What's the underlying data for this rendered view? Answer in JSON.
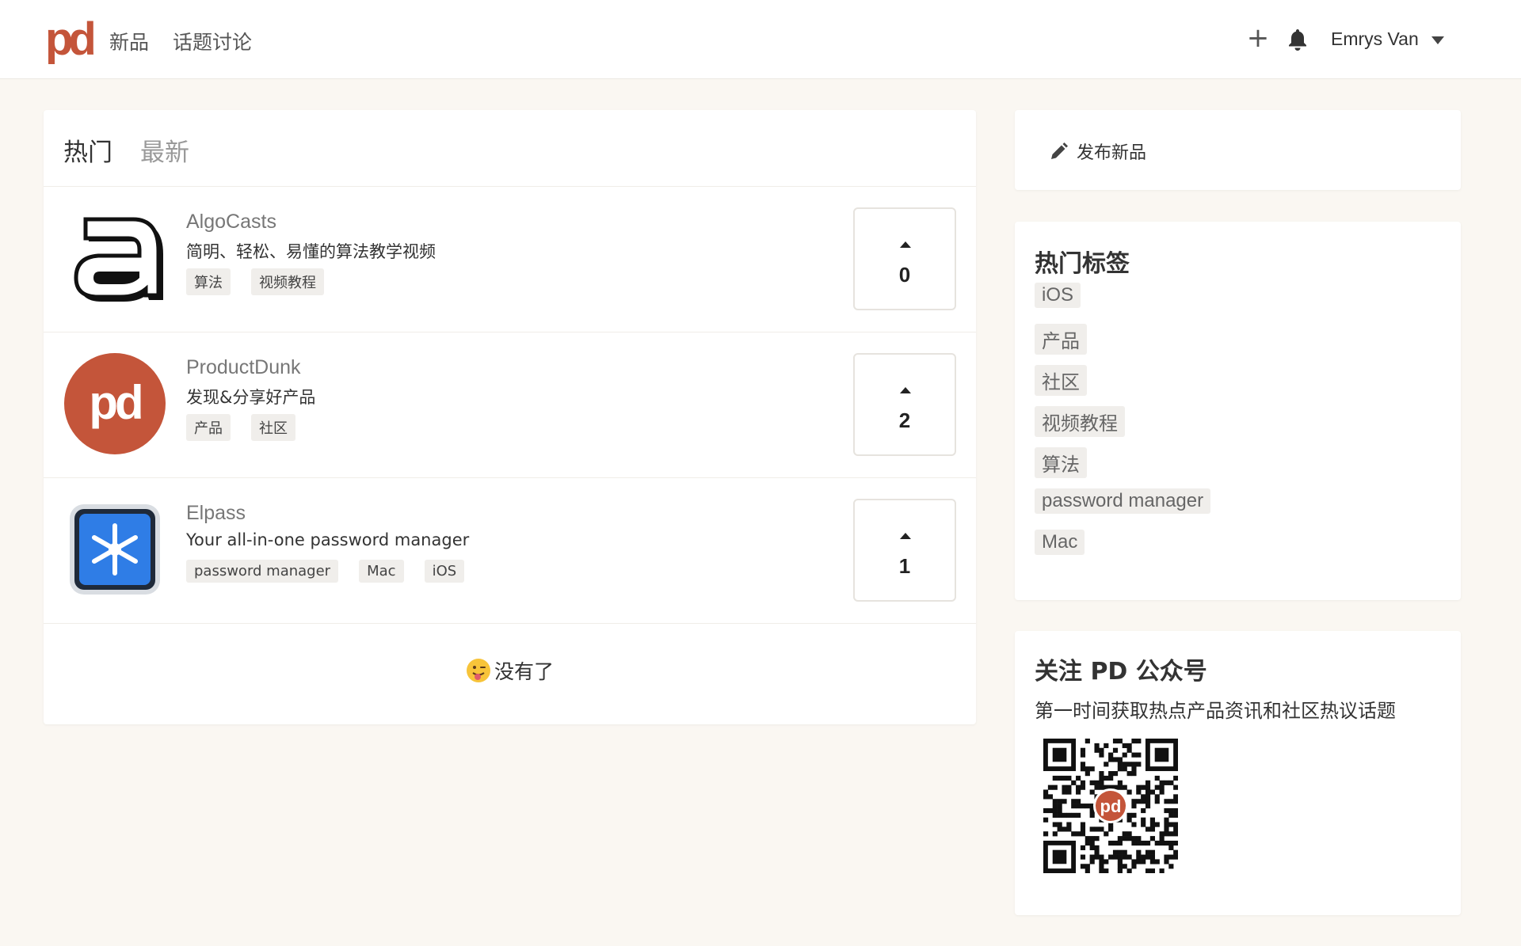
{
  "nav": {
    "logo": "pd",
    "links": [
      "新品",
      "话题讨论"
    ],
    "user_name": "Emrys Van"
  },
  "main": {
    "tabs": [
      {
        "label": "热门",
        "active": true
      },
      {
        "label": "最新",
        "active": false
      }
    ],
    "products": [
      {
        "name": "AlgoCasts",
        "description": "简明、轻松、易懂的算法教学视频",
        "tags": [
          "算法",
          "视频教程"
        ],
        "votes": 0,
        "icon": "algocasts-icon"
      },
      {
        "name": "ProductDunk",
        "description": "发现&分享好产品",
        "tags": [
          "产品",
          "社区"
        ],
        "votes": 2,
        "icon": "productdunk-icon"
      },
      {
        "name": "Elpass",
        "description": "Your all-in-one password manager",
        "tags": [
          "password manager",
          "Mac",
          "iOS"
        ],
        "votes": 1,
        "icon": "elpass-icon"
      }
    ],
    "end_message": "没有了"
  },
  "sidebar": {
    "publish_label": "发布新品",
    "hot_tags_title": "热门标签",
    "hot_tags": [
      "iOS",
      "产品",
      "社区",
      "视频教程",
      "算法",
      "password manager",
      "Mac"
    ],
    "follow_title": "关注 PD 公众号",
    "follow_subtitle": "第一时间获取热点产品资讯和社区热议话题"
  },
  "colors": {
    "brand": "#c4553a",
    "background": "#faf7f2",
    "tag_bg": "#f0eeeb"
  }
}
